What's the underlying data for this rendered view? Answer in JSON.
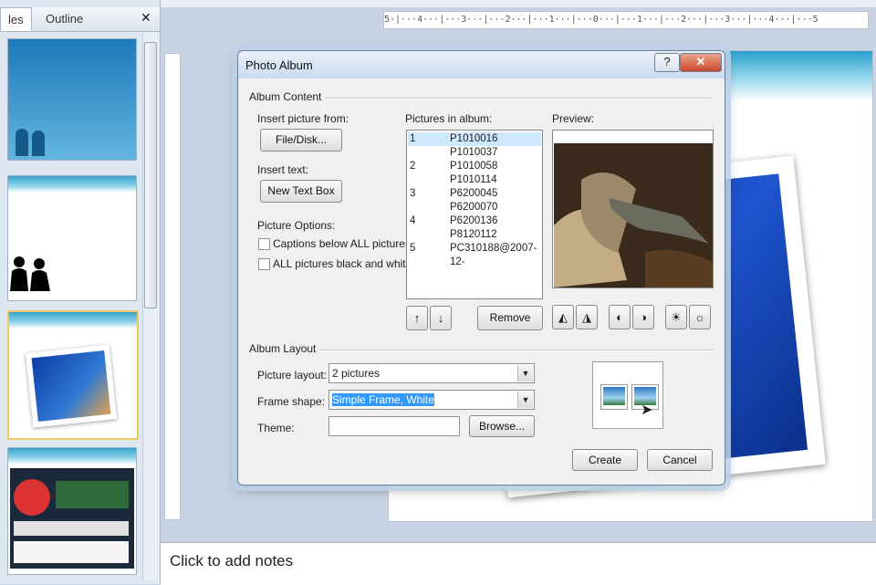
{
  "left_pane": {
    "tabs": [
      "les",
      "Outline"
    ],
    "close_glyph": "✕"
  },
  "ruler": {
    "h_text": "5·|···4···|···3···|···2···|···1···|···0···|···1···|···2···|···3···|···4···|···5"
  },
  "notes_placeholder": "Click to add notes",
  "dialog": {
    "title": "Photo Album",
    "help_label": "?",
    "close_label": "✕",
    "album_content_label": "Album Content",
    "insert_picture_from_label": "Insert picture from:",
    "file_disk_button": "File/Disk...",
    "insert_text_label": "Insert text:",
    "new_text_box_button": "New Text Box",
    "picture_options_label": "Picture Options:",
    "captions_option": "Captions below ALL pictures",
    "bw_option": "ALL pictures black and white",
    "pictures_in_album_label": "Pictures in album:",
    "pictures": [
      {
        "num": "1",
        "name": "P1010016",
        "selected": true
      },
      {
        "num": "",
        "name": "P1010037"
      },
      {
        "num": "2",
        "name": "P1010058"
      },
      {
        "num": "",
        "name": "P1010114"
      },
      {
        "num": "3",
        "name": "P6200045"
      },
      {
        "num": "",
        "name": "P6200070"
      },
      {
        "num": "4",
        "name": "P6200136"
      },
      {
        "num": "",
        "name": "P8120112"
      },
      {
        "num": "5",
        "name": "PC310188@2007-12-"
      }
    ],
    "move_up_glyph": "↑",
    "move_down_glyph": "↓",
    "remove_button": "Remove",
    "preview_label": "Preview:",
    "album_layout_label": "Album Layout",
    "picture_layout_label": "Picture layout:",
    "picture_layout_value": "2 pictures",
    "frame_shape_label": "Frame shape:",
    "frame_shape_value": "Simple Frame, White",
    "theme_label": "Theme:",
    "theme_value": "",
    "browse_button": "Browse...",
    "create_button": "Create",
    "cancel_button": "Cancel",
    "dropdown_glyph": "▼"
  },
  "colors": {
    "accent_blue": "#3399ff",
    "selection_row": "#cde8ff",
    "slide_wave": "#3aa3cc"
  }
}
